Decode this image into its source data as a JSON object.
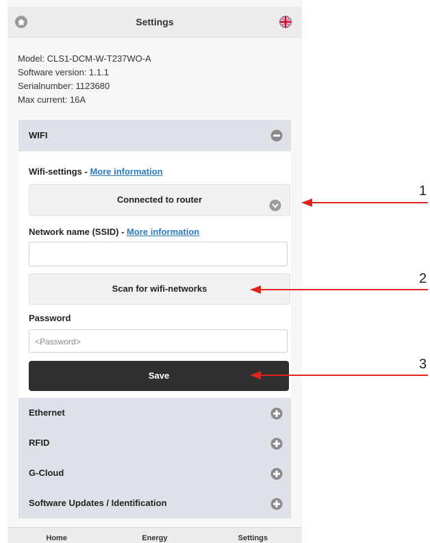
{
  "header": {
    "title": "Settings",
    "home_icon": "home-icon",
    "flag_icon": "uk-flag-icon"
  },
  "device_info": {
    "model": "Model: CLS1-DCM-W-T237WO-A",
    "software_version": "Software version: 1.1.1",
    "serial": "Serialnumber: 1123680",
    "max_current": "Max current: 16A"
  },
  "sections": {
    "wifi": {
      "label": "WIFI",
      "settings_label": "Wifi-settings - ",
      "settings_link": "More information",
      "connection_mode": "Connected to router",
      "ssid_label": "Network name (SSID) - ",
      "ssid_link": "More information",
      "ssid_value": "",
      "scan_button": "Scan for wifi-networks",
      "password_label": "Password",
      "password_placeholder": "<Password>",
      "save_button": "Save"
    },
    "ethernet": {
      "label": "Ethernet"
    },
    "rfid": {
      "label": "RFID"
    },
    "gcloud": {
      "label": "G-Cloud"
    },
    "updates": {
      "label": "Software Updates / Identification"
    }
  },
  "bottom_nav": {
    "home": "Home",
    "energy": "Energy",
    "settings": "Settings"
  },
  "annotations": {
    "a1": "1",
    "a2": "2",
    "a3": "3"
  },
  "colors": {
    "accent_link": "#2b7bc0",
    "save_bg": "#2f2f2f",
    "arrow": "#e0231c",
    "accordion_bg": "#dfe1e8"
  }
}
